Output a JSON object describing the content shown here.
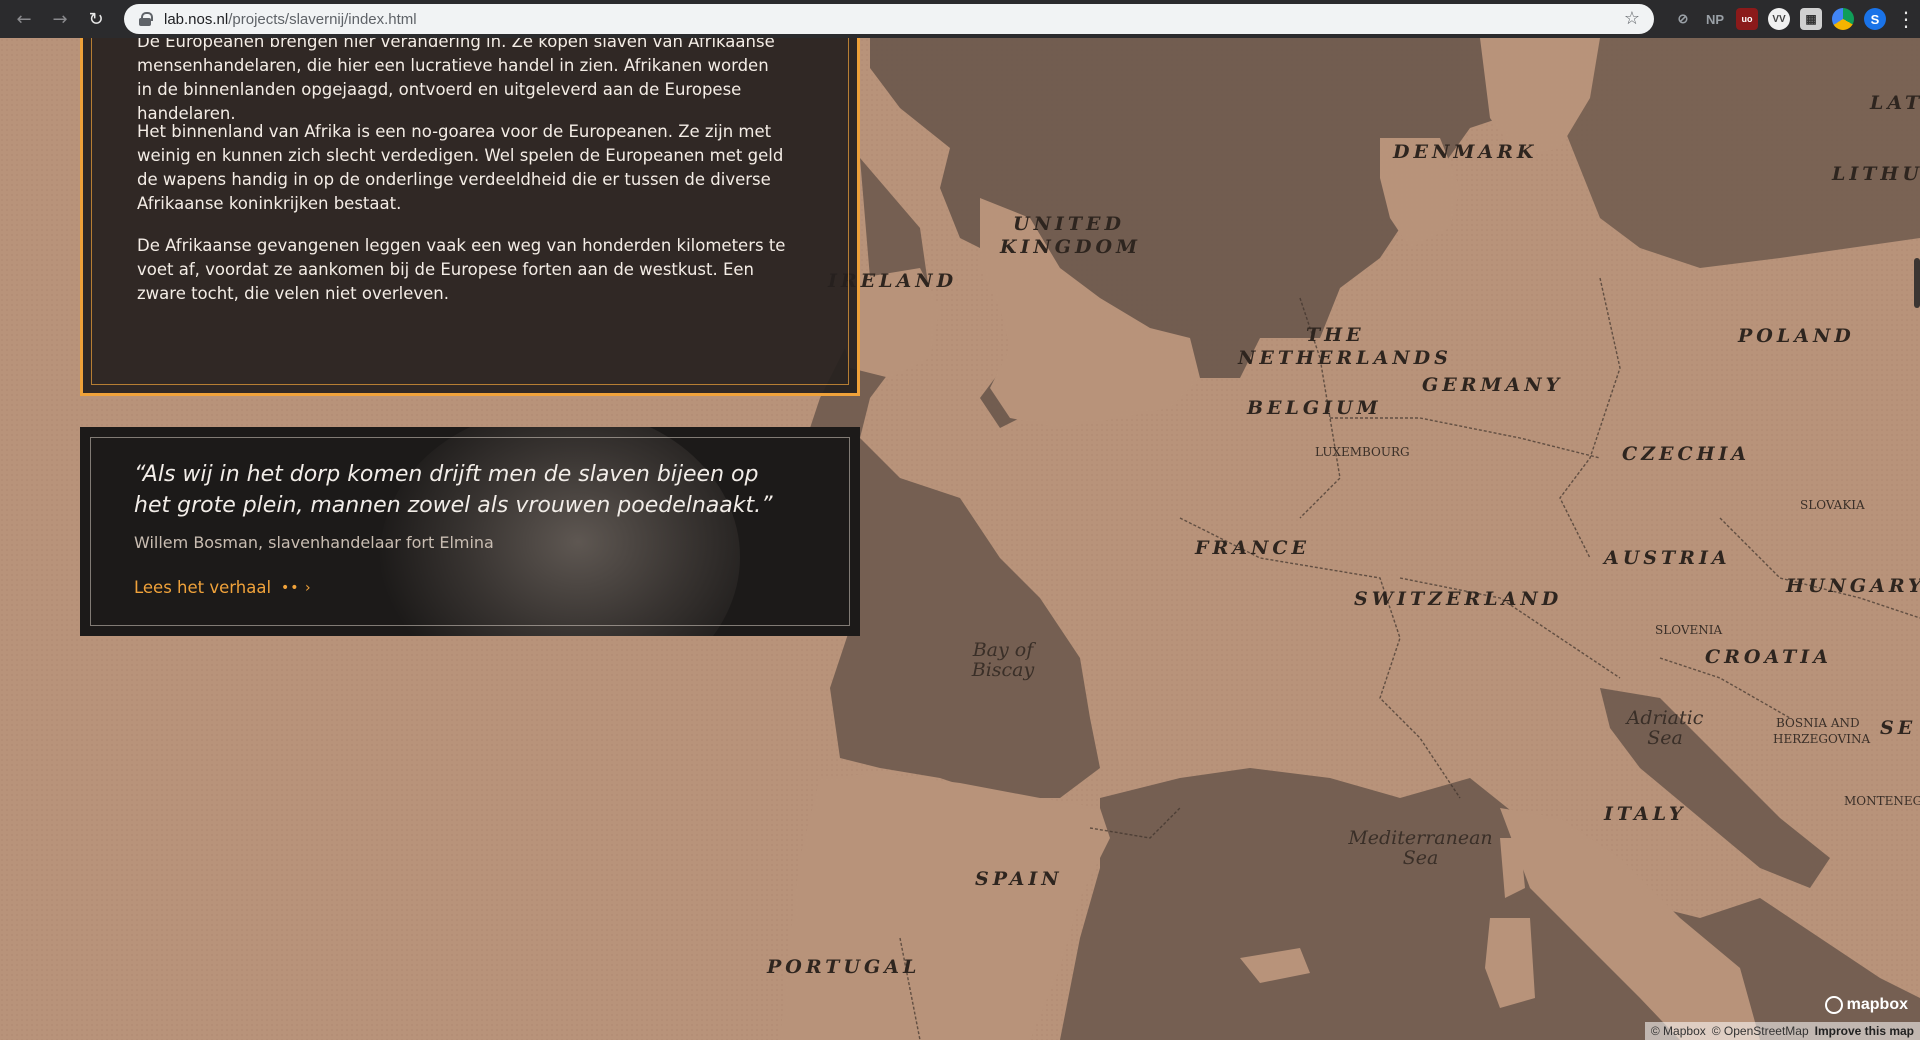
{
  "browser": {
    "url_host": "lab.nos.nl",
    "url_path": "/projects/slavernij/index.html",
    "extensions": {
      "np_label": "NP",
      "ublock_badge": "uo",
      "ublock_count": "7",
      "vv_label": "VV",
      "profile_initial": "S"
    }
  },
  "story": {
    "paragraphs": [
      "De Europeanen brengen hier verandering in. Ze kopen slaven van Afrikaanse mensenhandelaren, die hier een lucratieve handel in zien. Afrikanen worden in de binnenlanden opgejaagd, ontvoerd en uitgeleverd aan de Europese handelaren.",
      "Het binnenland van Afrika is een no-goarea voor de Europeanen. Ze zijn met weinig en kunnen zich slecht verdedigen. Wel spelen de Europeanen met geld de wapens handig in op de onderlinge verdeeldheid die er tussen de diverse Afrikaanse koninkrijken bestaat.",
      "De Afrikaanse gevangenen leggen vaak een weg van honderden kilometers te voet af, voordat ze aankomen bij de Europese forten aan de westkust. Een zware tocht, die velen niet overleven."
    ]
  },
  "quote": {
    "text": "“Als wij in het dorp komen drijft men de slaven bijeen op het grote plein, mannen zowel als vrouwen poedelnaakt.”",
    "author": "Willem Bosman, slavenhandelaar fort Elmina",
    "link_label": "Lees het verhaal"
  },
  "map": {
    "countries": {
      "denmark": "DENMARK",
      "united": "UNITED",
      "kingdom": "KINGDOM",
      "ireland": "IRELAND",
      "the": "THE",
      "netherlands": "NETHERLANDS",
      "belgium": "BELGIUM",
      "germany": "GERMANY",
      "poland": "POLAND",
      "czechia": "CZECHIA",
      "france": "FRANCE",
      "switzerland": "SWITZERLAND",
      "austria": "AUSTRIA",
      "hungary": "HUNGARY",
      "croatia": "CROATIA",
      "italy": "ITALY",
      "spain": "SPAIN",
      "portugal": "PORTUGAL",
      "lat": "LAT",
      "lithua": "LITHUA",
      "se": "SE"
    },
    "small_labels": {
      "luxembourg": "LUXEMBOURG",
      "slovakia": "SLOVAKIA",
      "slovenia": "SLOVENIA",
      "bosnia_1": "BOSNIA AND",
      "bosnia_2": "HERZEGOVINA",
      "montenegro": "MONTENEGR"
    },
    "seas": {
      "biscay_1": "Bay of",
      "biscay_2": "Biscay",
      "adriatic_1": "Adriatic",
      "adriatic_2": "Sea",
      "med_1": "Mediterranean",
      "med_2": "Sea"
    },
    "colors": {
      "land": "#b8937a",
      "water": "#6e5a4e",
      "accent": "#f0a23a"
    }
  },
  "mapbox": {
    "logo": "mapbox",
    "attribution_1": "© Mapbox",
    "attribution_2": "© OpenStreetMap",
    "improve": "Improve this map"
  }
}
